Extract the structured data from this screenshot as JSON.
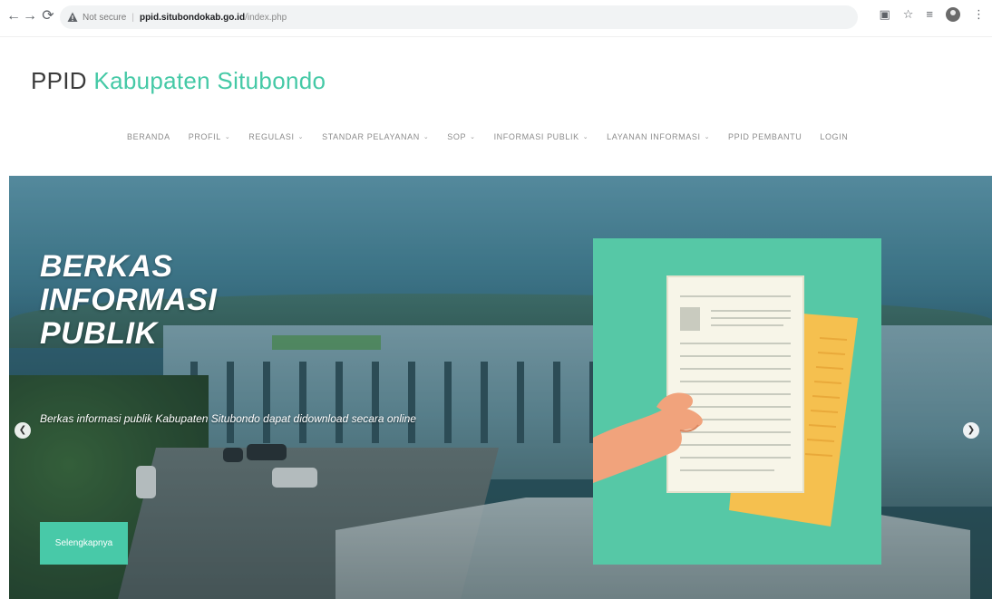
{
  "browser": {
    "back_icon": "arrow-left-icon",
    "forward_icon": "arrow-right-icon",
    "reload_icon": "reload-icon",
    "security_label": "Not secure",
    "url_host": "ppid.situbondokab.go.id",
    "url_path": "/index.php",
    "toolbar_icons": [
      "translate-icon",
      "star-icon",
      "playlist-icon",
      "profile-icon",
      "more-icon"
    ]
  },
  "header": {
    "title_prefix": "PPID",
    "title_accent": "Kabupaten Situbondo"
  },
  "nav": {
    "items": [
      {
        "label": "BERANDA",
        "dropdown": false
      },
      {
        "label": "PROFIL",
        "dropdown": true
      },
      {
        "label": "REGULASI",
        "dropdown": true
      },
      {
        "label": "STANDAR PELAYANAN",
        "dropdown": true
      },
      {
        "label": "SOP",
        "dropdown": true
      },
      {
        "label": "INFORMASI PUBLIK",
        "dropdown": true
      },
      {
        "label": "LAYANAN INFORMASI",
        "dropdown": true
      },
      {
        "label": "PPID PEMBANTU",
        "dropdown": false
      },
      {
        "label": "LOGIN",
        "dropdown": false
      }
    ]
  },
  "hero": {
    "heading_line1": "BERKAS",
    "heading_line2": "INFORMASI",
    "heading_line3": "PUBLIK",
    "description": "Berkas informasi publik Kabupaten Situbondo dapat didownload secara online",
    "button_label": "Selengkapnya",
    "prev_icon": "chevron-left-icon",
    "next_icon": "chevron-right-icon"
  },
  "colors": {
    "accent": "#45c9a6",
    "button": "#48c9a8",
    "illustration_bg": "#56c8a6",
    "paper_yellow": "#f5c04f",
    "paper_white": "#f7f5e8"
  }
}
